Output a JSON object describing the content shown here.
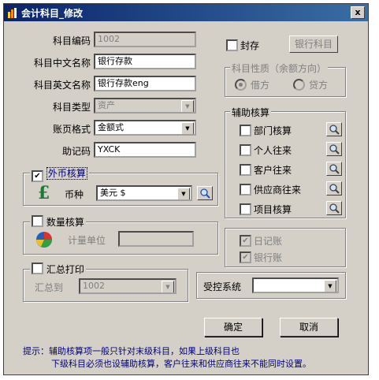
{
  "window": {
    "title": "会计科目_修改",
    "close_glyph": "x"
  },
  "basic": {
    "code_label": "科目编码",
    "code_value": "1002",
    "cn_name_label": "科目中文名称",
    "cn_name_value": "银行存款",
    "en_name_label": "科目英文名称",
    "en_name_value": "银行存款eng",
    "type_label": "科目类型",
    "type_value": "资产",
    "format_label": "账页格式",
    "format_value": "金额式",
    "mnemonic_label": "助记码",
    "mnemonic_value": "YXCK"
  },
  "seal": {
    "label": "封存",
    "checked": false,
    "button_label": "银行科目"
  },
  "nature": {
    "title": "科目性质（余额方向）",
    "debit": "借方",
    "credit": "贷方",
    "selected": "debit"
  },
  "aux": {
    "title": "辅助核算",
    "items": [
      {
        "label": "部门核算",
        "checked": false
      },
      {
        "label": "个人往来",
        "checked": false
      },
      {
        "label": "客户往来",
        "checked": false
      },
      {
        "label": "供应商往来",
        "checked": false
      },
      {
        "label": "项目核算",
        "checked": false
      }
    ]
  },
  "foreign": {
    "title": "外币核算",
    "checked": true,
    "currency_label": "币种",
    "currency_value": "美元 $"
  },
  "quantity": {
    "title": "数量核算",
    "checked": false,
    "unit_label": "计量单位",
    "unit_value": ""
  },
  "journal": {
    "daily_label": "日记账",
    "daily_checked": true,
    "bank_label": "银行账",
    "bank_checked": true
  },
  "summary": {
    "title": "汇总打印",
    "checked": false,
    "to_label": "汇总到",
    "to_value": "1002"
  },
  "controlled": {
    "label": "受控系统",
    "value": ""
  },
  "buttons": {
    "ok": "确定",
    "cancel": "取消"
  },
  "hint": {
    "line1": "提示：辅助核算项一般只针对末级科目，如果上级科目也",
    "line2": "下级科目必须也设辅助核算，客户往来和供应商往来不能同时设置。"
  },
  "colors": {
    "titlebar": "#0a246a",
    "hint": "#000080",
    "pound_icon": "#1a7a3a"
  }
}
